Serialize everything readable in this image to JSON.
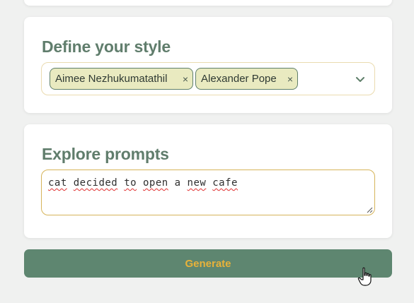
{
  "style_section": {
    "title": "Define your style",
    "tags": [
      {
        "label": "Aimee Nezhukumatathil",
        "remove": "×"
      },
      {
        "label": "Alexander Pope",
        "remove": "×"
      }
    ]
  },
  "prompts_section": {
    "title": "Explore prompts",
    "value_words": [
      "cat",
      "decided",
      "to",
      "open",
      "a",
      "new",
      "cafe"
    ]
  },
  "generate": {
    "label": "Generate"
  },
  "colors": {
    "accent_green": "#5e8670",
    "button_text": "#e8b23a",
    "title": "#607d6c",
    "tag_bg": "#e9eac0"
  },
  "icons": {
    "dropdown": "chevron-down-icon",
    "cursor": "hand-pointer-icon"
  }
}
